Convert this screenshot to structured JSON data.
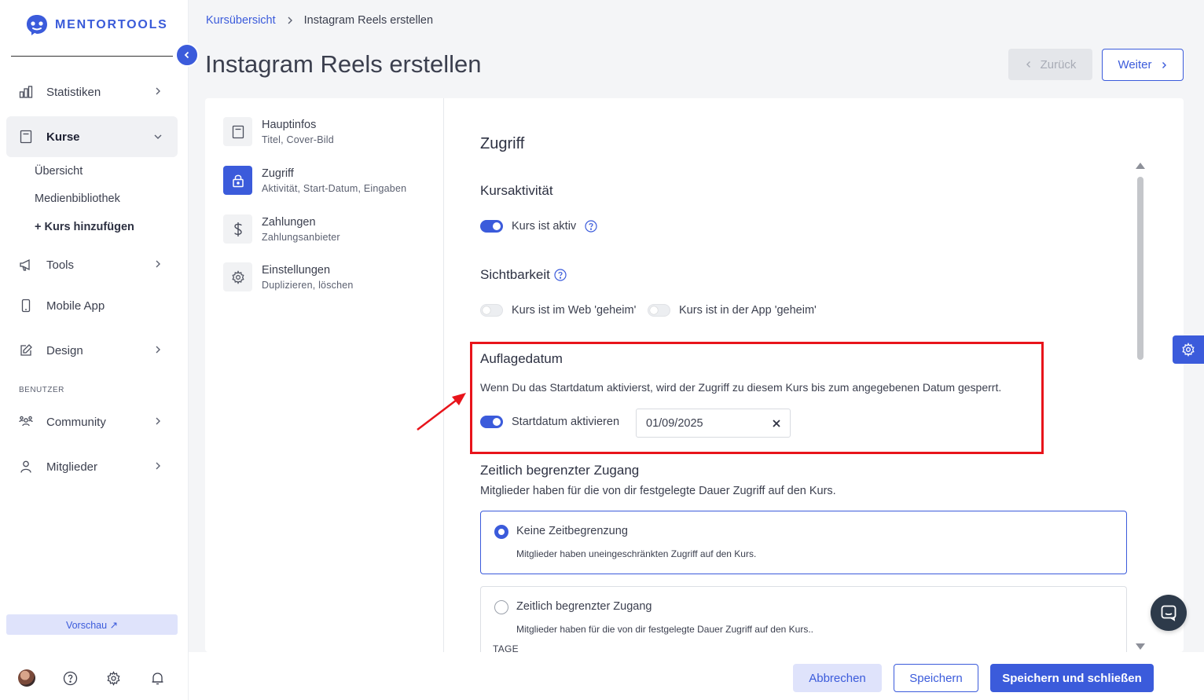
{
  "brand": {
    "name": "MENTORTOOLS",
    "accent": "#3b5bdb",
    "highlight": "#e8141b"
  },
  "sidebar": {
    "items": [
      {
        "label": "Statistiken",
        "icon": "bar-chart-icon"
      },
      {
        "label": "Kurse",
        "icon": "book-icon"
      },
      {
        "label": "Tools",
        "icon": "megaphone-icon"
      },
      {
        "label": "Mobile App",
        "icon": "phone-icon"
      },
      {
        "label": "Design",
        "icon": "edit-icon"
      },
      {
        "label": "Community",
        "icon": "people-icon"
      },
      {
        "label": "Mitglieder",
        "icon": "user-icon"
      }
    ],
    "sub_items": [
      "Übersicht",
      "Medienbibliothek",
      "+ Kurs hinzufügen"
    ],
    "section_label": "BENUTZER",
    "preview_label": "Vorschau ↗"
  },
  "breadcrumb": {
    "parent": "Kursübersicht",
    "current": "Instagram Reels erstellen"
  },
  "page": {
    "title": "Instagram Reels erstellen",
    "back_label": "Zurück",
    "next_label": "Weiter"
  },
  "steps": [
    {
      "title": "Hauptinfos",
      "sub": "Titel, Cover-Bild"
    },
    {
      "title": "Zugriff",
      "sub": "Aktivität, Start-Datum, Eingaben"
    },
    {
      "title": "Zahlungen",
      "sub": "Zahlungsanbieter"
    },
    {
      "title": "Einstellungen",
      "sub": "Duplizieren, löschen"
    }
  ],
  "access": {
    "heading": "Zugriff",
    "activity": {
      "title": "Kursaktivität",
      "toggle_label": "Kurs ist aktiv",
      "on": true
    },
    "visibility": {
      "title": "Sichtbarkeit",
      "web_label": "Kurs ist im Web 'geheim'",
      "app_label": "Kurs ist in der App 'geheim'",
      "web_on": false,
      "app_on": false
    },
    "release": {
      "title": "Auflagedatum",
      "description": "Wenn Du das Startdatum aktivierst, wird der Zugriff zu diesem Kurs bis zum angegebenen Datum gesperrt.",
      "toggle_label": "Startdatum aktivieren",
      "on": true,
      "date": "01/09/2025"
    },
    "limited": {
      "title": "Zeitlich begrenzter Zugang",
      "description": "Mitglieder haben für die von dir festgelegte Dauer Zugriff auf den Kurs.",
      "options": [
        {
          "title": "Keine Zeitbegrenzung",
          "sub": "Mitglieder haben uneingeschränkten Zugriff auf den Kurs.",
          "selected": true
        },
        {
          "title": "Zeitlich begrenzter Zugang",
          "sub": "Mitglieder haben für die von dir festgelegte Dauer Zugriff auf den Kurs..",
          "extra": "TAGE",
          "selected": false
        }
      ]
    }
  },
  "footer": {
    "cancel_label": "Abbrechen",
    "save_label": "Speichern",
    "save_close_label": "Speichern und schließen"
  }
}
